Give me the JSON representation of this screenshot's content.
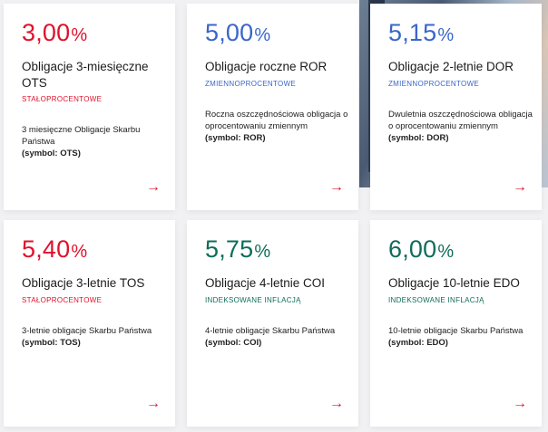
{
  "cards": [
    {
      "rate": "3,00",
      "pct": "%",
      "color": "#e0112b",
      "title": "Obligacje 3-miesięczne OTS",
      "type": "STAŁOPROCENTOWE",
      "desc": "3 miesięczne Obligacje Skarbu Państwa",
      "symbol": "(symbol: OTS)",
      "arrow": "→"
    },
    {
      "rate": "5,00",
      "pct": "%",
      "color": "#3a66c9",
      "title": "Obligacje roczne ROR",
      "type": "ZMIENNOPROCENTOWE",
      "desc": "Roczna oszczędnościowa obligacja o oprocentowaniu zmiennym",
      "symbol": "(symbol: ROR)",
      "arrow": "→"
    },
    {
      "rate": "5,15",
      "pct": "%",
      "color": "#3a66c9",
      "title": "Obligacje 2-letnie DOR",
      "type": "ZMIENNOPROCENTOWE",
      "desc": "Dwuletnia oszczędnościowa obligacja o oprocentowaniu zmiennym",
      "symbol": "(symbol: DOR)",
      "arrow": "→"
    },
    {
      "rate": "5,40",
      "pct": "%",
      "color": "#e0112b",
      "title": "Obligacje 3-letnie TOS",
      "type": "STAŁOPROCENTOWE",
      "desc": "3-letnie obligacje Skarbu Państwa",
      "symbol": "(symbol: TOS)",
      "arrow": "→"
    },
    {
      "rate": "5,75",
      "pct": "%",
      "color": "#0f6d5a",
      "title": "Obligacje 4-letnie COI",
      "type": "INDEKSOWANE INFLACJĄ",
      "desc": "4-letnie obligacje Skarbu Państwa",
      "symbol": "(symbol: COI)",
      "arrow": "→"
    },
    {
      "rate": "6,00",
      "pct": "%",
      "color": "#0f6d5a",
      "title": "Obligacje 10-letnie EDO",
      "type": "INDEKSOWANE INFLACJĄ",
      "desc": "10-letnie obligacje Skarbu Państwa",
      "symbol": "(symbol: EDO)",
      "arrow": "→"
    }
  ]
}
